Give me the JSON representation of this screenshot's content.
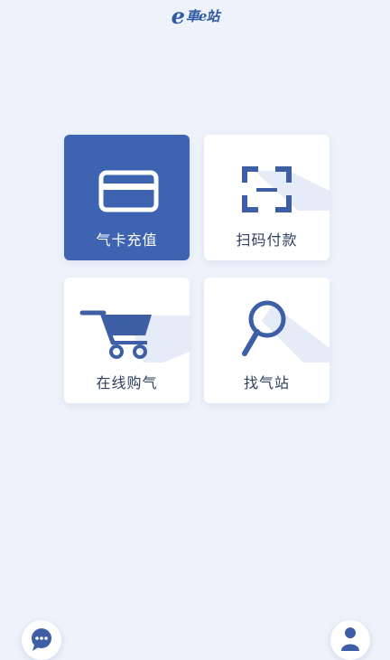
{
  "header": {
    "logo_e": "e",
    "logo_text": "車e站"
  },
  "menu": {
    "items": [
      {
        "label": "气卡充值",
        "icon": "card-icon",
        "active": true
      },
      {
        "label": "扫码付款",
        "icon": "scan-icon",
        "active": false
      },
      {
        "label": "在线购气",
        "icon": "cart-icon",
        "active": false
      },
      {
        "label": "找气站",
        "icon": "search-icon",
        "active": false
      }
    ]
  },
  "floating": {
    "chat_icon": "chat-icon",
    "profile_icon": "user-icon"
  },
  "colors": {
    "accent": "#3e63b0",
    "icon": "#3e5fa6",
    "background": "#eef3fb"
  }
}
